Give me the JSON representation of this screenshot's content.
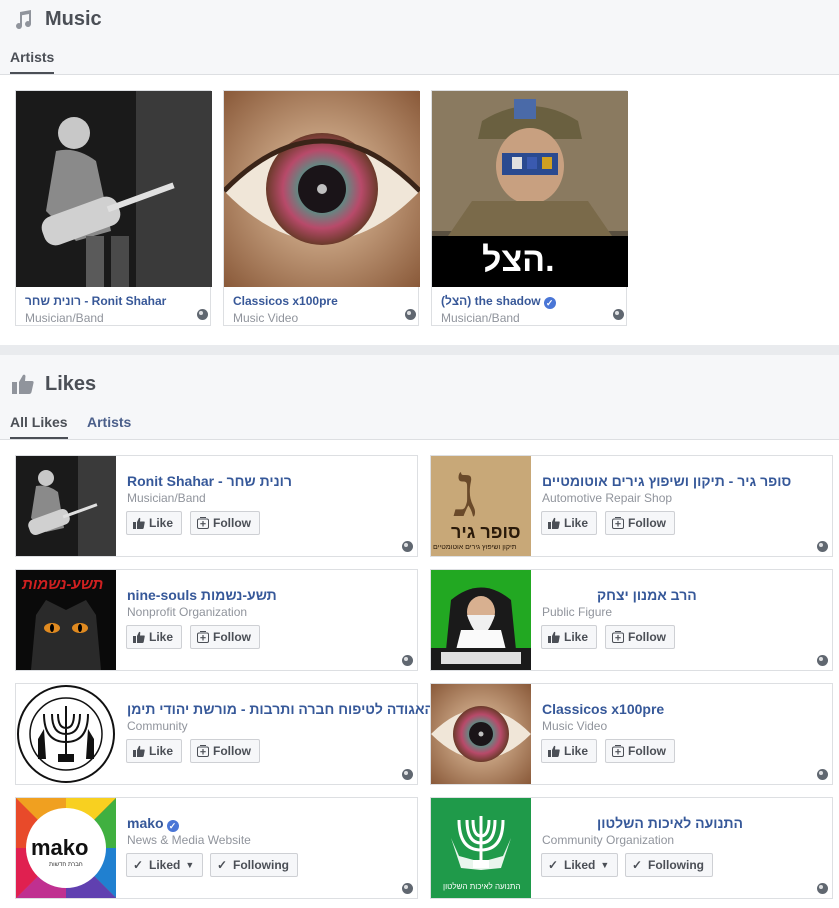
{
  "music": {
    "title": "Music",
    "tab": "Artists",
    "artists": [
      {
        "name": "רונית שחר - Ronit Shahar",
        "category": "Musician/Band"
      },
      {
        "name": "Classicos x100pre",
        "category": "Music Video"
      },
      {
        "name": "(הצל) the shadow",
        "category": "Musician/Band",
        "verified": true
      }
    ],
    "shadow_logo": "הצל."
  },
  "likes": {
    "title": "Likes",
    "tabs": [
      "All Likes",
      "Artists"
    ],
    "pages": [
      {
        "name": "Ronit Shahar - רונית שחר",
        "category": "Musician/Band",
        "like": "Like",
        "follow": "Follow"
      },
      {
        "name": "סופר גיר - תיקון ושיפוץ גירים אוטומטיים",
        "category": "Automotive Repair Shop",
        "like": "Like",
        "follow": "Follow"
      },
      {
        "name": "nine-souls תשע-נשמות",
        "category": "Nonprofit Organization",
        "like": "Like",
        "follow": "Follow"
      },
      {
        "name": "הרב אמנון יצחק",
        "category": "Public Figure",
        "like": "Like",
        "follow": "Follow"
      },
      {
        "name": "האגודה לטיפוח חברה ותרבות - מורשת יהודי תימן",
        "category": "Community",
        "like": "Like",
        "follow": "Follow"
      },
      {
        "name": "Classicos x100pre",
        "category": "Music Video",
        "like": "Like",
        "follow": "Follow"
      },
      {
        "name": "mako",
        "category": "News & Media Website",
        "like": "Liked",
        "follow": "Following",
        "verified": true
      },
      {
        "name": "התנועה לאיכות השלטון",
        "category": "Community Organization",
        "like": "Liked",
        "follow": "Following"
      }
    ],
    "thumb_text": {
      "super_gear_letter": "ג",
      "super_gear_title": "סופר גיר",
      "super_gear_sub": "תיקון ושיפוץ גירים אוטומטיים",
      "nine_souls": "תשע-נשמות",
      "mako": "mako",
      "mako_sub": "חברת חדשות",
      "movement": "התנועה לאיכות השלטון"
    }
  }
}
